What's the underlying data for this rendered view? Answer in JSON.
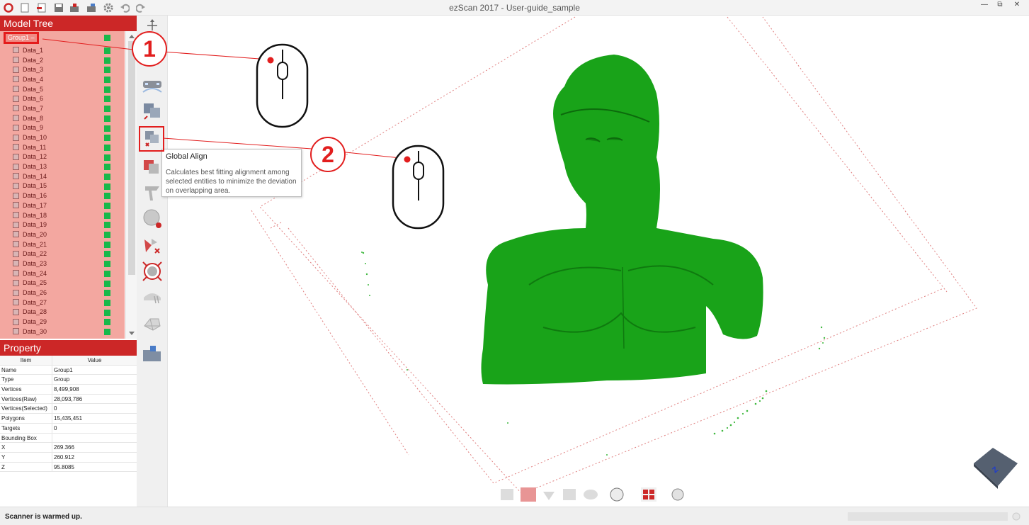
{
  "app": {
    "title": "ezScan 2017 - User-guide_sample"
  },
  "quick_access": [
    "logo-icon",
    "new-file-icon",
    "import-icon",
    "save-icon",
    "export-icon",
    "share-icon",
    "settings-icon",
    "undo-icon",
    "redo-icon"
  ],
  "window_controls": [
    "minimize-icon",
    "restore-icon",
    "close-icon"
  ],
  "window_glyphs": {
    "minimize": "—",
    "restore": "⧉",
    "close": "✕"
  },
  "model_tree": {
    "header": "Model Tree",
    "group_label": "Group1",
    "items": [
      "Data_1",
      "Data_2",
      "Data_3",
      "Data_4",
      "Data_5",
      "Data_6",
      "Data_7",
      "Data_8",
      "Data_9",
      "Data_10",
      "Data_11",
      "Data_12",
      "Data_13",
      "Data_14",
      "Data_15",
      "Data_16",
      "Data_17",
      "Data_18",
      "Data_19",
      "Data_20",
      "Data_21",
      "Data_22",
      "Data_23",
      "Data_24",
      "Data_25",
      "Data_26",
      "Data_27",
      "Data_28",
      "Data_29",
      "Data_30"
    ]
  },
  "property": {
    "header": "Property",
    "columns": [
      "Item",
      "Value"
    ],
    "rows": [
      {
        "item": "Name",
        "value": "Group1"
      },
      {
        "item": "Type",
        "value": "Group"
      },
      {
        "item": "Vertices",
        "value": "8,499,908"
      },
      {
        "item": "Vertices(Raw)",
        "value": "28,093,786"
      },
      {
        "item": "Vertices(Selected)",
        "value": "0"
      },
      {
        "item": "Polygons",
        "value": "15,435,451"
      },
      {
        "item": "Targets",
        "value": "0"
      },
      {
        "item": "Bounding Box",
        "value": ""
      },
      {
        "item": "X",
        "value": "269.366"
      },
      {
        "item": "Y",
        "value": "260.912"
      },
      {
        "item": "Z",
        "value": "95.8085"
      }
    ]
  },
  "toolbar": [
    "move-icon",
    "scanner-settings-icon",
    "manual-align-icon",
    "global-align-icon",
    "merge-icon",
    "smooth-icon",
    "sphere-icon",
    "delete-points-icon",
    "target-icon",
    "hole-fill-icon",
    "mesh-icon",
    "open-folder-icon"
  ],
  "tooltip": {
    "title": "Global Align",
    "description": "Calculates best fitting alignment among selected entities to minimize the deviation on overlapping area."
  },
  "callouts": {
    "one": "1",
    "two": "2"
  },
  "bottom_toolbar": [
    "view-back-icon",
    "view-front-icon",
    "view-down-icon",
    "view-box-icon",
    "view-ellipse-icon",
    "fit-icon",
    "quad-view-icon",
    "rotate-icon"
  ],
  "orientation_cube": {
    "label": "Z"
  },
  "status": {
    "message": "Scanner is warmed up."
  },
  "colors": {
    "accent_red": "#cc2727",
    "selection": "#f3a7a0",
    "model_green": "#19a319",
    "visibility_green": "#18b84a"
  }
}
